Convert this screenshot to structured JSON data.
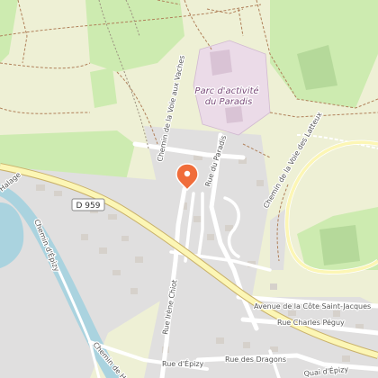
{
  "map": {
    "poi": {
      "line1": "Parc d'activité",
      "line2": "du Paradis"
    },
    "route_shield": "D 959",
    "streets": {
      "voie_aux_vaches": "Chemin de la Voie aux Vaches",
      "rue_du_paradis": "Rue du Paradis",
      "voie_des_latteux": "Chemin de la Voie des Latteux",
      "cote_saint_jacques": "Avenue de la Côte Saint-Jacques",
      "charles_peguy": "Rue Charles Péguy",
      "irene_chiot": "Rue Irène Chiot",
      "chemin_epizy": "Chemin d'Épizy",
      "rue_epizy": "Rue d'Épizy",
      "quai_epizy": "Quai d'Épizy",
      "rue_dragons": "Rue des Dragons",
      "chemin_halage": "Chemin de Halage",
      "halage": "Halage"
    },
    "marker_icon": "map-pin-icon",
    "colors": {
      "farmland": "#eef0d5",
      "meadow": "#cdebb0",
      "residential": "#e0dfdf",
      "industrial": "#ebdbe8",
      "water": "#aad3df",
      "primary_road": "#fcf6b5",
      "marker": "#f06d3b"
    }
  }
}
